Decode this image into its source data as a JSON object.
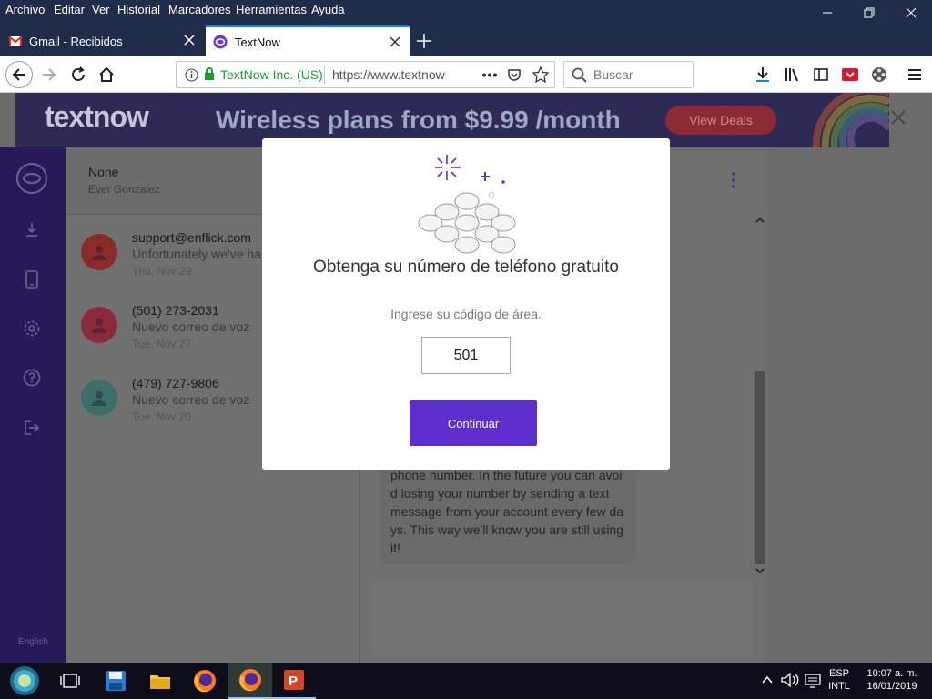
{
  "menubar": {
    "items": [
      "Archivo",
      "Editar",
      "Ver",
      "Historial",
      "Marcadores",
      "Herramientas",
      "Ayuda"
    ]
  },
  "tabs": [
    {
      "label": "Gmail - Recibidos",
      "icon": "gmail-icon"
    },
    {
      "label": "TextNow",
      "icon": "textnow-icon",
      "active": true
    }
  ],
  "navbar": {
    "site_identity": "TextNow Inc. (US)",
    "url": "https://www.textnow",
    "search_placeholder": "Buscar"
  },
  "banner": {
    "logo": "textnow",
    "headline": "Wireless plans from $9.99 /month",
    "cta": "View Deals"
  },
  "sidebar": {
    "icons": [
      "textnow-logo-icon",
      "download-icon",
      "phone-icon",
      "settings-icon",
      "help-icon",
      "logout-icon"
    ],
    "language": "English"
  },
  "conversation_header": {
    "name": "None",
    "subtitle": "Ever Gonzalez"
  },
  "conversations": [
    {
      "title": "support@enflick.com",
      "preview": "Unfortunately we've ha",
      "date": "Thu, Nov 29",
      "avatar_color": "#8a2a2a"
    },
    {
      "title": "(501) 273-2031",
      "preview": "Nuevo correo de voz",
      "date": "Tue, Nov 27",
      "avatar_color": "#8a2a3a"
    },
    {
      "title": "(479) 727-9806",
      "preview": "Nuevo correo de voz",
      "date": "Tue, Nov 20",
      "avatar_color": "#3d6f6a"
    }
  ],
  "message_bubble": {
    "lines": [
      "phone number. In the future you can avoi",
      "d losing your number by sending a text",
      "message from your account every few da",
      "ys. This way we'll know you are still using",
      "it!"
    ]
  },
  "modal": {
    "title": "Obtenga su número de teléfono gratuito",
    "prompt": "Ingrese su código de área.",
    "area_code": "501",
    "button": "Continuar"
  },
  "taskbar": {
    "apps": [
      "start-icon",
      "task-view-icon",
      "save-icon",
      "file-explorer-icon",
      "firefox-icon",
      "firefox-icon",
      "powerpoint-icon"
    ],
    "language_line1": "ESP",
    "language_line2": "INTL",
    "time": "10:07 a. m.",
    "date": "16/01/2019"
  },
  "colors": {
    "accent_purple": "#5c2fcc",
    "sidebar_purple": "#281a58",
    "firefox_blue": "#0a84ff",
    "secure_green": "#12a12b"
  }
}
